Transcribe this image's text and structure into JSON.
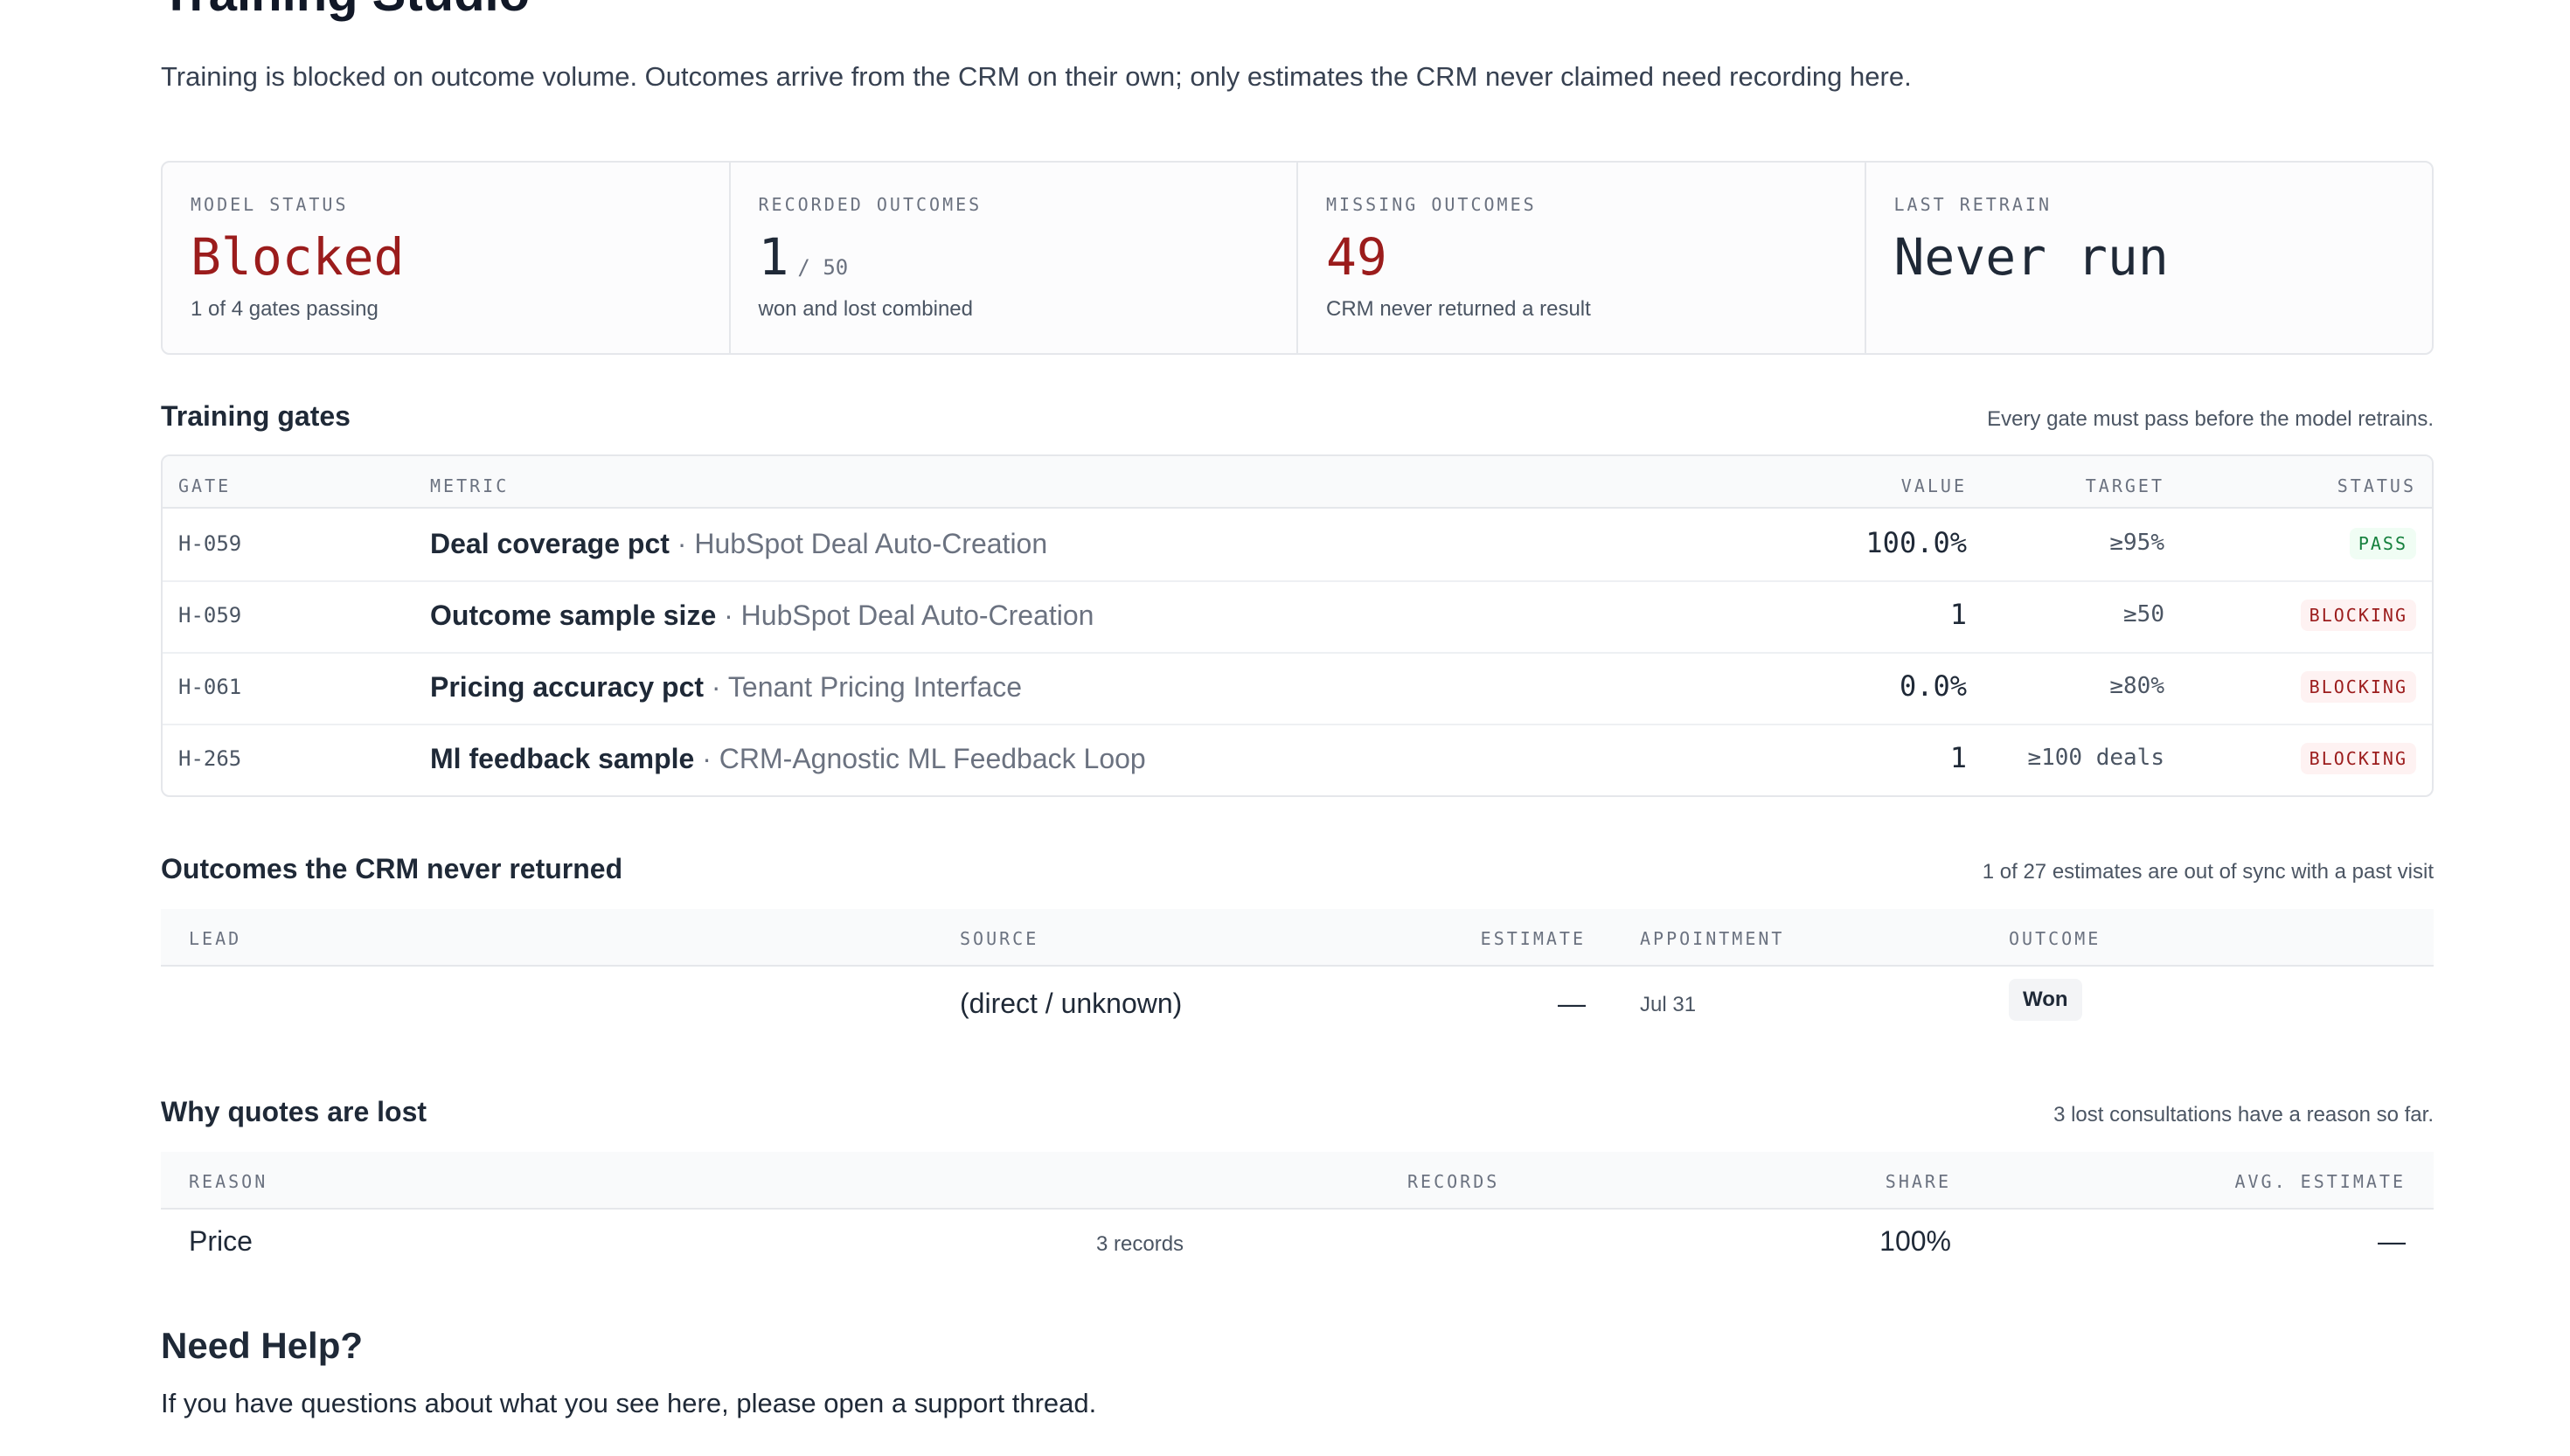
{
  "page": {
    "title": "Training Studio",
    "intro": "Training is blocked on outcome volume. Outcomes arrive from the CRM on their own; only estimates the CRM never claimed need recording here."
  },
  "kpis": [
    {
      "label": "MODEL STATUS",
      "value": "Blocked",
      "unit": "",
      "sub": "1 of 4 gates passing",
      "color": "#9b1c1c"
    },
    {
      "label": "RECORDED OUTCOMES",
      "value": "1",
      "unit": "/ 50",
      "sub": "won and lost combined",
      "color": "#1f2937"
    },
    {
      "label": "MISSING OUTCOMES",
      "value": "49",
      "unit": "",
      "sub": "CRM never returned a result",
      "color": "#9b1c1c"
    },
    {
      "label": "LAST RETRAIN",
      "value": "Never run",
      "unit": "",
      "sub": "",
      "color": "#1f2937"
    }
  ],
  "gates": {
    "title": "Training gates",
    "note": "Every gate must pass before the model retrains.",
    "headers": {
      "gate": "GATE",
      "metric": "METRIC",
      "value": "VALUE",
      "target": "TARGET",
      "status": "STATUS"
    },
    "rows": [
      {
        "gate": "H-059",
        "metric": "Deal coverage pct",
        "source": "· HubSpot Deal Auto-Creation",
        "value": "100.0%",
        "target": "≥95%",
        "status": "PASS"
      },
      {
        "gate": "H-059",
        "metric": "Outcome sample size",
        "source": "· HubSpot Deal Auto-Creation",
        "value": "1",
        "target": "≥50",
        "status": "BLOCKING"
      },
      {
        "gate": "H-061",
        "metric": "Pricing accuracy pct",
        "source": "· Tenant Pricing Interface",
        "value": "0.0%",
        "target": "≥80%",
        "status": "BLOCKING"
      },
      {
        "gate": "H-265",
        "metric": "Ml feedback sample",
        "source": "· CRM-Agnostic ML Feedback Loop",
        "value": "1",
        "target": "≥100 deals",
        "status": "BLOCKING"
      }
    ]
  },
  "outcomes": {
    "title": "Outcomes the CRM never returned",
    "note": "1 of 27 estimates are out of sync with a past visit",
    "headers": {
      "lead": "LEAD",
      "source": "SOURCE",
      "estimate": "ESTIMATE",
      "appointment": "APPOINTMENT",
      "outcome": "OUTCOME"
    },
    "rows": [
      {
        "lead": "",
        "source": "(direct / unknown)",
        "estimate": "—",
        "appointment": "Jul 31",
        "outcome": "Won"
      }
    ]
  },
  "reasons": {
    "title": "Why quotes are lost",
    "note": "3 lost consultations have a reason so far.",
    "headers": {
      "reason": "REASON",
      "records": "RECORDS",
      "share": "SHARE",
      "avg": "AVG. ESTIMATE"
    },
    "rows": [
      {
        "reason": "Price",
        "records": "3 records",
        "share": "100%",
        "avg": "—"
      }
    ]
  },
  "help": {
    "title": "Need Help?",
    "text": "If you have questions about what you see here, please open a support thread."
  }
}
